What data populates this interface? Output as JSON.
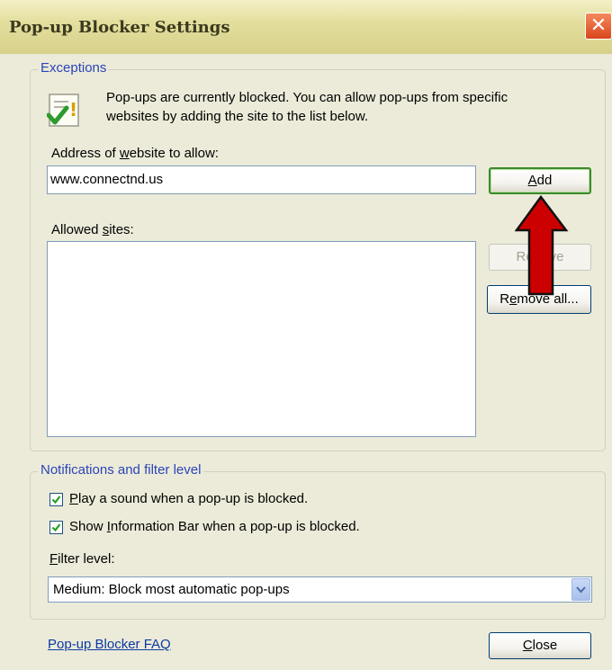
{
  "window": {
    "title": "Pop-up Blocker Settings",
    "close_glyph": "✕"
  },
  "exceptions": {
    "legend": "Exceptions",
    "info_line1": "Pop-ups are currently blocked.  You can allow pop-ups from specific",
    "info_line2": "websites by adding the site to the list below.",
    "address_label_pre": "Address of ",
    "address_label_u": "w",
    "address_label_post": "ebsite to allow:",
    "address_value": "www.connectnd.us",
    "add_label_u": "A",
    "add_label_post": "dd",
    "allowed_label_pre": "Allowed ",
    "allowed_label_u": "s",
    "allowed_label_post": "ites:",
    "allowed_sites": [],
    "remove_label_pre": "Re",
    "remove_label_post": "ve",
    "remove_all_pre": "R",
    "remove_all_u": "e",
    "remove_all_post": "move all..."
  },
  "notifications": {
    "legend": "Notifications and filter level",
    "play_sound_u": "P",
    "play_sound_post": "lay a sound when a pop-up is blocked.",
    "play_sound_checked": true,
    "show_bar_pre": "Show ",
    "show_bar_u": "I",
    "show_bar_post": "nformation Bar when a pop-up is blocked.",
    "show_bar_checked": true,
    "filter_label_u": "F",
    "filter_label_post": "ilter level:",
    "filter_value": "Medium: Block most automatic pop-ups"
  },
  "footer": {
    "faq_link": "Pop-up Blocker FAQ",
    "close_u": "C",
    "close_post": "lose"
  },
  "colors": {
    "arrow": "#cc0000",
    "legend_text": "#2a44b8",
    "link": "#0b3aa4"
  },
  "icons": [
    "info-check-icon",
    "checkbox-check-icon",
    "dropdown-arrow-icon",
    "red-arrow-annotation"
  ]
}
